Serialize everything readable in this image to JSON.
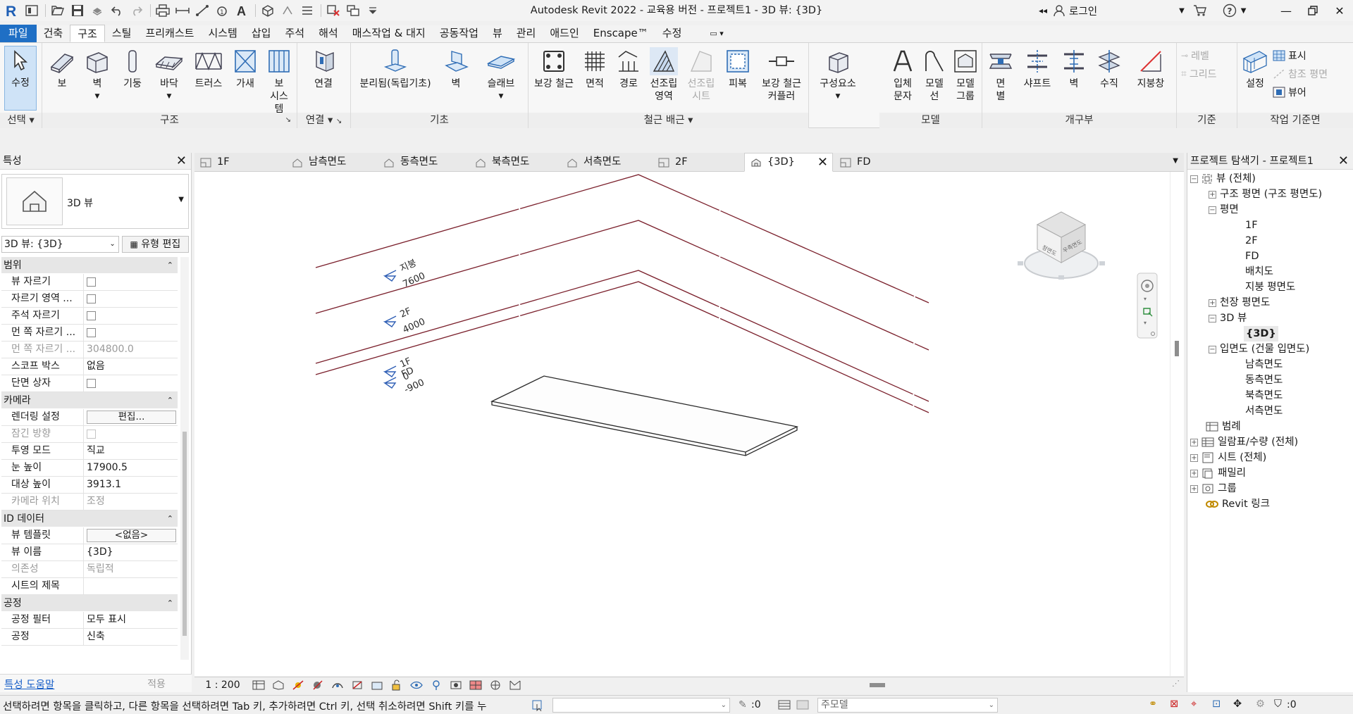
{
  "app": {
    "title": "Autodesk Revit 2022 - 교육용 버전 - 프로젝트1 - 3D 뷰: {3D}",
    "login": "로그인"
  },
  "ribbon_tabs": [
    "파일",
    "건축",
    "구조",
    "스틸",
    "프리캐스트",
    "시스템",
    "삽입",
    "주석",
    "해석",
    "매스작업 & 대지",
    "공동작업",
    "뷰",
    "관리",
    "애드인",
    "Enscape™",
    "수정"
  ],
  "active_tab": "구조",
  "ribbon": {
    "select_panel": {
      "title": "선택",
      "modify": "수정"
    },
    "structure_panel": {
      "title": "구조",
      "beam": "보",
      "wall": "벽",
      "column": "기둥",
      "floor": "바닥",
      "truss": "트러스",
      "brace": "가새",
      "beam_system": "보 시스템"
    },
    "connection_panel": {
      "title": "연결",
      "connection": "연결"
    },
    "foundation_panel": {
      "title": "기초",
      "isolated": "분리됨(독립기초)",
      "wall": "벽",
      "slab": "슬래브"
    },
    "rebar_panel": {
      "title": "철근 배근",
      "rebar": "보강 철근",
      "area": "면적",
      "path": "경로",
      "fabric_area": "선조립 영역",
      "fabric_sheet": "선조립 시트",
      "cover": "피복",
      "coupler": "보강 철근 커플러"
    },
    "model_panel": {
      "title": "모델",
      "component": "구성요소",
      "model_text": "입체 문자",
      "model_line": "모델 선",
      "model_group": "모델 그룹"
    },
    "opening_panel": {
      "title": "개구부",
      "by_face": "면별",
      "shaft": "샤프트",
      "wall": "벽",
      "vertical": "수직",
      "dormer": "지붕창"
    },
    "datum_panel": {
      "title": "기준",
      "level": "레벨",
      "grid": "그리드"
    },
    "workplane_panel": {
      "title": "작업 기준면",
      "set": "설정",
      "show": "표시",
      "ref_plane": "참조 평면",
      "viewer": "뷰어"
    }
  },
  "properties": {
    "header": "특성",
    "type_name": "3D 뷰",
    "instance_select": "3D 뷰: {3D}",
    "edit_type": "유형 편집",
    "groups": [
      {
        "name": "범위",
        "rows": [
          {
            "k": "뷰 자르기",
            "type": "check",
            "dim": false
          },
          {
            "k": "자르기 영역 ...",
            "type": "check",
            "dim": false
          },
          {
            "k": "주석 자르기",
            "type": "check",
            "dim": false
          },
          {
            "k": "먼 쪽 자르기 ...",
            "type": "check",
            "dim": false
          },
          {
            "k": "먼 쪽 자르기 ...",
            "v": "304800.0",
            "type": "text",
            "dim": true
          },
          {
            "k": "스코프 박스",
            "v": "없음",
            "type": "text",
            "dim": false
          },
          {
            "k": "단면 상자",
            "type": "check",
            "dim": false
          }
        ]
      },
      {
        "name": "카메라",
        "rows": [
          {
            "k": "렌더링 설정",
            "v": "편집...",
            "type": "button",
            "dim": false
          },
          {
            "k": "잠긴 방향",
            "type": "check",
            "dim": true
          },
          {
            "k": "투영 모드",
            "v": "직교",
            "type": "text",
            "dim": false
          },
          {
            "k": "눈 높이",
            "v": "17900.5",
            "type": "text",
            "dim": false
          },
          {
            "k": "대상 높이",
            "v": "3913.1",
            "type": "text",
            "dim": false
          },
          {
            "k": "카메라 위치",
            "v": "조정",
            "type": "text",
            "dim": true
          }
        ]
      },
      {
        "name": "ID 데이터",
        "rows": [
          {
            "k": "뷰 템플릿",
            "v": "<없음>",
            "type": "button",
            "dim": false
          },
          {
            "k": "뷰 이름",
            "v": "{3D}",
            "type": "text",
            "dim": false
          },
          {
            "k": "의존성",
            "v": "독립적",
            "type": "text",
            "dim": true
          },
          {
            "k": "시트의 제목",
            "v": "",
            "type": "text",
            "dim": false
          }
        ]
      },
      {
        "name": "공정",
        "rows": [
          {
            "k": "공정 필터",
            "v": "모두 표시",
            "type": "text",
            "dim": false
          },
          {
            "k": "공정",
            "v": "신축",
            "type": "text",
            "dim": false
          }
        ]
      }
    ],
    "help_link": "특성 도움말",
    "apply": "적용"
  },
  "view_tabs": [
    {
      "label": "1F",
      "icon": "floor-plan-icon",
      "active": false
    },
    {
      "label": "남측면도",
      "icon": "elevation-icon",
      "active": false
    },
    {
      "label": "동측면도",
      "icon": "elevation-icon",
      "active": false
    },
    {
      "label": "북측면도",
      "icon": "elevation-icon",
      "active": false
    },
    {
      "label": "서측면도",
      "icon": "elevation-icon",
      "active": false
    },
    {
      "label": "2F",
      "icon": "floor-plan-icon",
      "active": false
    },
    {
      "label": "{3D}",
      "icon": "3d-view-icon",
      "active": true
    },
    {
      "label": "FD",
      "icon": "floor-plan-icon",
      "active": false
    }
  ],
  "levels": [
    {
      "name": "지붕",
      "elev": "7600"
    },
    {
      "name": "2F",
      "elev": "4000"
    },
    {
      "name": "1F",
      "elev": "0"
    },
    {
      "name": "FD",
      "elev": "-900"
    }
  ],
  "viewcube": {
    "front": "정면도",
    "right": "우측면도"
  },
  "scale": "1 : 200",
  "browser": {
    "header": "프로젝트 탐색기 - 프로젝트1",
    "nodes": {
      "views": "뷰 (전체)",
      "struct_plans": "구조 평면 (구조 평면도)",
      "floor_plans": "평면",
      "fp_1f": "1F",
      "fp_2f": "2F",
      "fp_fd": "FD",
      "fp_site": "배치도",
      "fp_roof": "지붕 평면도",
      "ceiling_plans": "천장 평면도",
      "views_3d": "3D 뷰",
      "v3d": "{3D}",
      "elevations": "입면도 (건물 입면도)",
      "el_s": "남측면도",
      "el_e": "동측면도",
      "el_n": "북측면도",
      "el_w": "서측면도",
      "legends": "범례",
      "schedules": "일람표/수량 (전체)",
      "sheets": "시트 (전체)",
      "families": "패밀리",
      "groups": "그룹",
      "links": "Revit 링크"
    }
  },
  "status": {
    "message": "선택하려면 항목을 클릭하고, 다른 항목을 선택하려면 Tab 키, 추가하려면 Ctrl 키, 선택 취소하려면 Shift 키를 누",
    "count": ":0",
    "model": "주모델",
    "filter_count": ":0"
  },
  "colors": {
    "accent": "#1f6fc5",
    "level_line": "#7a1f2b",
    "level_symbol": "#2f5fb5"
  }
}
